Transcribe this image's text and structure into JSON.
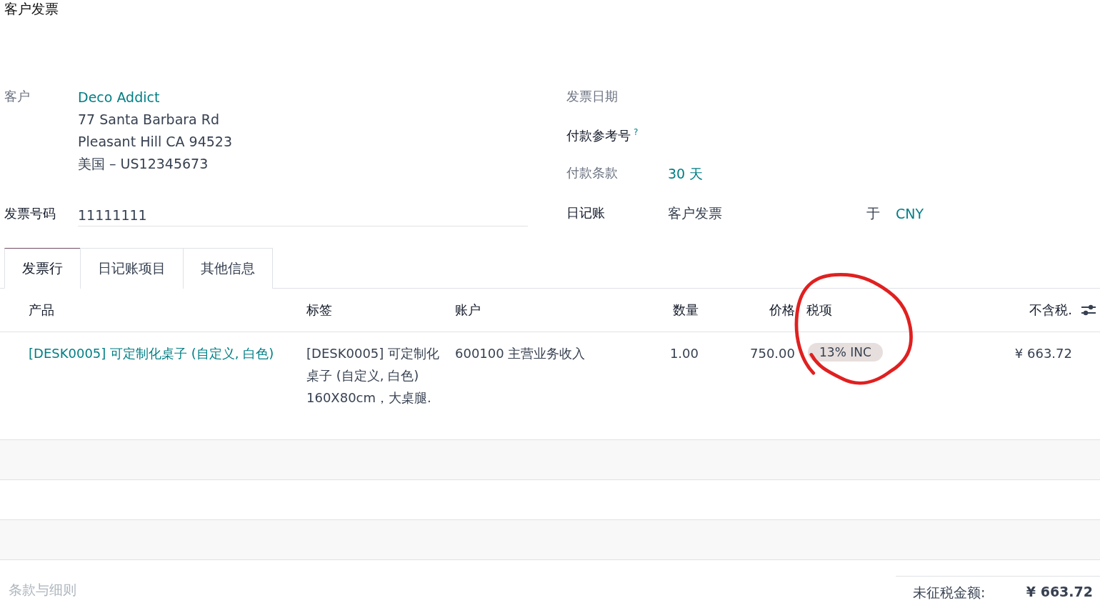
{
  "title": "客户发票",
  "customer": {
    "label": "客户",
    "required": false,
    "name": "Deco Addict",
    "address": [
      "77 Santa Barbara Rd",
      "Pleasant Hill CA 94523",
      "美国 – US12345673"
    ]
  },
  "invoice_number": {
    "label": "发票号码",
    "required": true,
    "value": "11111111"
  },
  "invoice_date": {
    "label": "发票日期",
    "required": false
  },
  "payment_reference": {
    "label": "付款参考号",
    "required": true,
    "help": "?"
  },
  "payment_terms": {
    "label": "付款条款",
    "required": false,
    "value": "30 天"
  },
  "journal": {
    "label": "日记账",
    "required": true,
    "value": "客户发票",
    "in_label": "于",
    "currency": "CNY"
  },
  "tabs": [
    {
      "label": "发票行",
      "selected": true
    },
    {
      "label": "日记账项目",
      "selected": false
    },
    {
      "label": "其他信息",
      "selected": false
    }
  ],
  "table": {
    "columns": [
      {
        "label": "产品"
      },
      {
        "label": "标签"
      },
      {
        "label": "账户"
      },
      {
        "label": "数量"
      },
      {
        "label": "价格"
      },
      {
        "label": "税项"
      },
      {
        "label": "不含税."
      }
    ],
    "rows": [
      {
        "product": "[DESK0005] 可定制化桌子 (自定义, 白色)",
        "label": "[DESK0005] 可定制化桌子 (自定义, 白色)\n160X80cm，大桌腿.",
        "account": "600100 主营业务收入",
        "quantity": "1.00",
        "price": "750.00",
        "taxes": [
          "13% INC"
        ],
        "subtotal": "¥ 663.72"
      }
    ]
  },
  "terms": {
    "placeholder": "条款与细则"
  },
  "totals": [
    {
      "label": "未征税金额:",
      "value": "¥ 663.72"
    }
  ]
}
